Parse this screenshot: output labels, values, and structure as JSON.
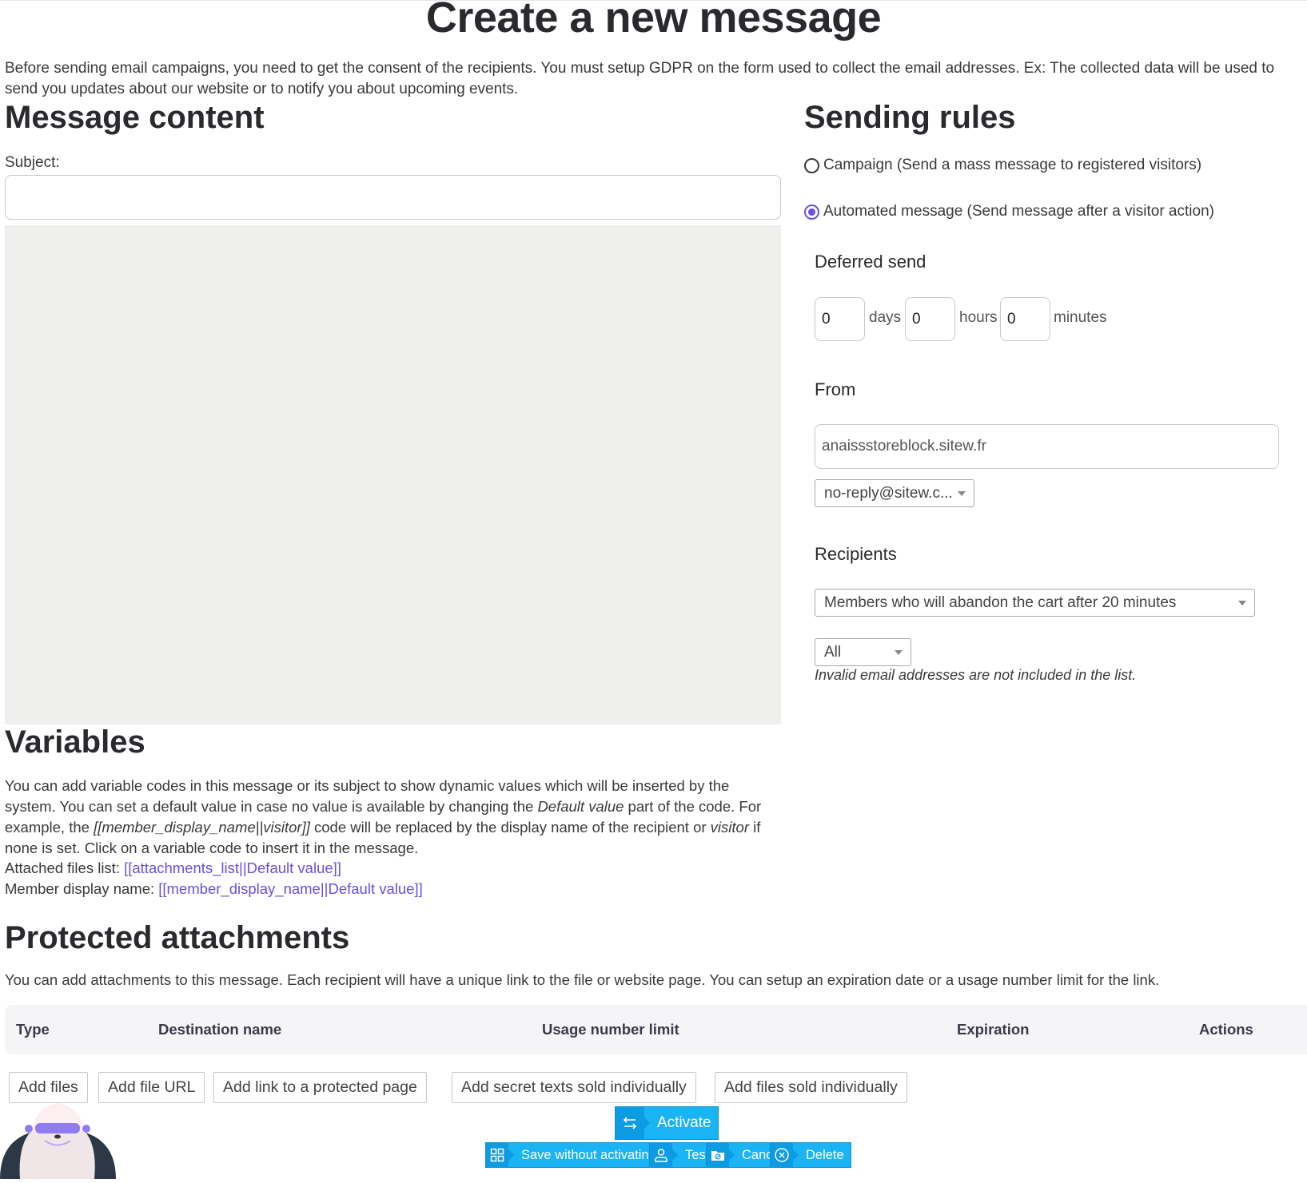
{
  "page": {
    "title": "Create a new message",
    "intro": "Before sending email campaigns, you need to get the consent of the recipients. You must setup GDPR on the form used to collect the email addresses. Ex: The collected data will be used to send you updates about our website or to notify you about upcoming events."
  },
  "message_content": {
    "heading": "Message content",
    "subject_label": "Subject:",
    "subject_value": ""
  },
  "sending_rules": {
    "heading": "Sending rules",
    "options": [
      {
        "label": "Campaign (Send a mass message to registered visitors)",
        "checked": false
      },
      {
        "label": "Automated message (Send message after a visitor action)",
        "checked": true
      }
    ],
    "deferred_send": {
      "heading": "Deferred send",
      "days": "0",
      "days_label": "days",
      "hours": "0",
      "hours_label": "hours",
      "minutes": "0",
      "minutes_label": "minutes"
    },
    "from": {
      "heading": "From",
      "name_value": "anaissstoreblock.sitew.fr",
      "email_select": "no-reply@sitew.c..."
    },
    "recipients": {
      "heading": "Recipients",
      "group_select": "Members who will abandon the cart after 20 minutes",
      "filter_select": "All",
      "hint": "Invalid email addresses are not included in the list."
    }
  },
  "variables": {
    "heading": "Variables",
    "desc_part1": "You can add variable codes in this message or its subject to show dynamic values which will be inserted by the system. You can set a default value in case no value is available by changing the ",
    "desc_em1": "Default value",
    "desc_part2": " part of the code. For example, the ",
    "desc_em2": "[[member_display_name||visitor]]",
    "desc_part3": " code will be replaced by the display name of the recipient or ",
    "desc_em3": "visitor",
    "desc_part4": " if none is set. Click on a variable code to insert it in the message.",
    "items": [
      {
        "label": "Attached files list: ",
        "code": "[[attachments_list||Default value]]"
      },
      {
        "label": "Member display name: ",
        "code": "[[member_display_name||Default value]]"
      }
    ]
  },
  "attachments": {
    "heading": "Protected attachments",
    "desc": "You can add attachments to this message. Each recipient will have a unique link to the file or website page. You can setup an expiration date or a usage number limit for the link.",
    "columns": [
      "Type",
      "Destination name",
      "Usage number limit",
      "Expiration",
      "Actions"
    ],
    "add_buttons": [
      "Add files",
      "Add file URL",
      "Add link to a protected page",
      "Add secret texts sold individually",
      "Add files sold individually"
    ]
  },
  "actions": {
    "activate": "Activate",
    "save_without_activating": "Save without activating",
    "test": "Test",
    "cancel": "Cancel",
    "delete": "Delete"
  },
  "colors": {
    "accent": "#6a4fe0",
    "action_button": "#1ab4f5",
    "action_icon_bg": "#0d9be3",
    "editor_bg": "#efefed"
  }
}
